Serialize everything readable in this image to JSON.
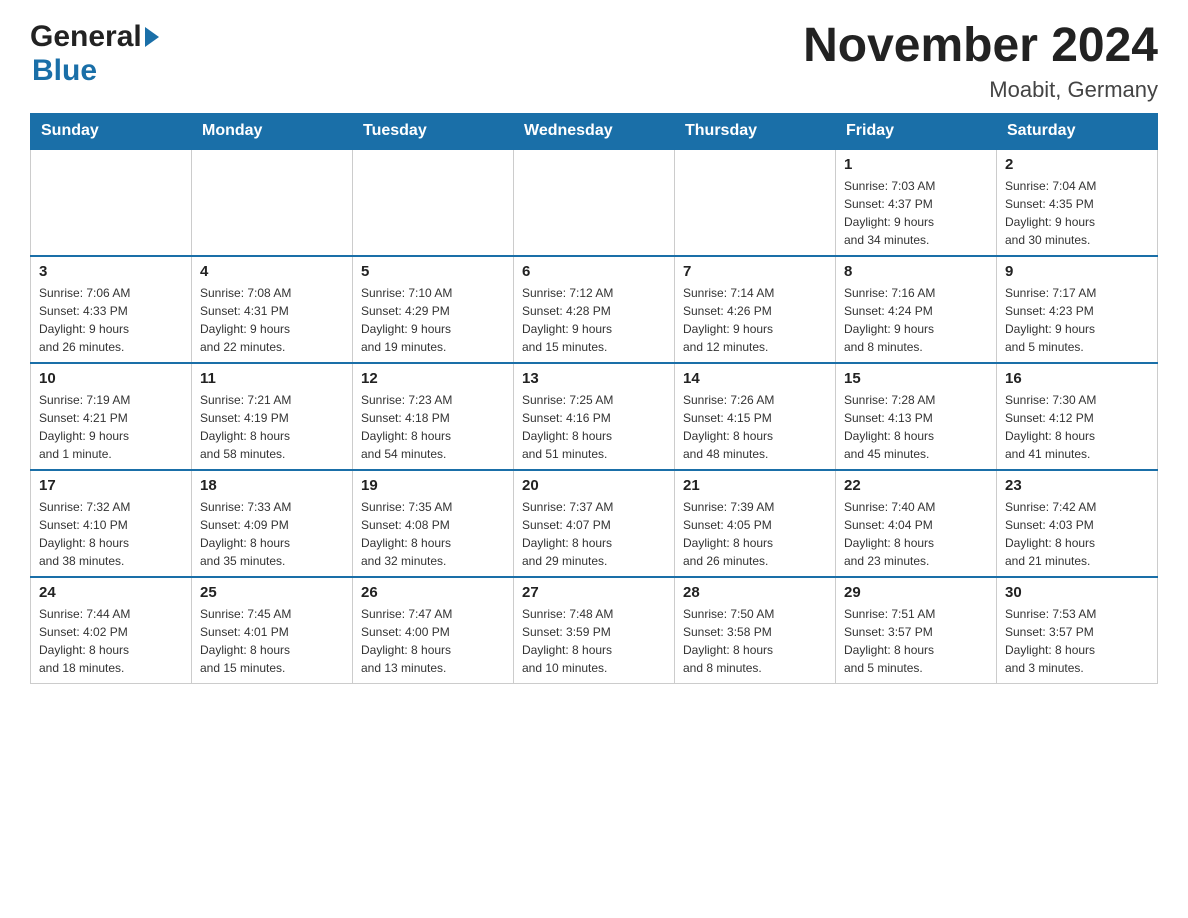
{
  "header": {
    "title": "November 2024",
    "subtitle": "Moabit, Germany",
    "logo_general": "General",
    "logo_blue": "Blue"
  },
  "weekdays": [
    "Sunday",
    "Monday",
    "Tuesday",
    "Wednesday",
    "Thursday",
    "Friday",
    "Saturday"
  ],
  "weeks": [
    {
      "days": [
        {
          "number": "",
          "info": ""
        },
        {
          "number": "",
          "info": ""
        },
        {
          "number": "",
          "info": ""
        },
        {
          "number": "",
          "info": ""
        },
        {
          "number": "",
          "info": ""
        },
        {
          "number": "1",
          "info": "Sunrise: 7:03 AM\nSunset: 4:37 PM\nDaylight: 9 hours\nand 34 minutes."
        },
        {
          "number": "2",
          "info": "Sunrise: 7:04 AM\nSunset: 4:35 PM\nDaylight: 9 hours\nand 30 minutes."
        }
      ]
    },
    {
      "days": [
        {
          "number": "3",
          "info": "Sunrise: 7:06 AM\nSunset: 4:33 PM\nDaylight: 9 hours\nand 26 minutes."
        },
        {
          "number": "4",
          "info": "Sunrise: 7:08 AM\nSunset: 4:31 PM\nDaylight: 9 hours\nand 22 minutes."
        },
        {
          "number": "5",
          "info": "Sunrise: 7:10 AM\nSunset: 4:29 PM\nDaylight: 9 hours\nand 19 minutes."
        },
        {
          "number": "6",
          "info": "Sunrise: 7:12 AM\nSunset: 4:28 PM\nDaylight: 9 hours\nand 15 minutes."
        },
        {
          "number": "7",
          "info": "Sunrise: 7:14 AM\nSunset: 4:26 PM\nDaylight: 9 hours\nand 12 minutes."
        },
        {
          "number": "8",
          "info": "Sunrise: 7:16 AM\nSunset: 4:24 PM\nDaylight: 9 hours\nand 8 minutes."
        },
        {
          "number": "9",
          "info": "Sunrise: 7:17 AM\nSunset: 4:23 PM\nDaylight: 9 hours\nand 5 minutes."
        }
      ]
    },
    {
      "days": [
        {
          "number": "10",
          "info": "Sunrise: 7:19 AM\nSunset: 4:21 PM\nDaylight: 9 hours\nand 1 minute."
        },
        {
          "number": "11",
          "info": "Sunrise: 7:21 AM\nSunset: 4:19 PM\nDaylight: 8 hours\nand 58 minutes."
        },
        {
          "number": "12",
          "info": "Sunrise: 7:23 AM\nSunset: 4:18 PM\nDaylight: 8 hours\nand 54 minutes."
        },
        {
          "number": "13",
          "info": "Sunrise: 7:25 AM\nSunset: 4:16 PM\nDaylight: 8 hours\nand 51 minutes."
        },
        {
          "number": "14",
          "info": "Sunrise: 7:26 AM\nSunset: 4:15 PM\nDaylight: 8 hours\nand 48 minutes."
        },
        {
          "number": "15",
          "info": "Sunrise: 7:28 AM\nSunset: 4:13 PM\nDaylight: 8 hours\nand 45 minutes."
        },
        {
          "number": "16",
          "info": "Sunrise: 7:30 AM\nSunset: 4:12 PM\nDaylight: 8 hours\nand 41 minutes."
        }
      ]
    },
    {
      "days": [
        {
          "number": "17",
          "info": "Sunrise: 7:32 AM\nSunset: 4:10 PM\nDaylight: 8 hours\nand 38 minutes."
        },
        {
          "number": "18",
          "info": "Sunrise: 7:33 AM\nSunset: 4:09 PM\nDaylight: 8 hours\nand 35 minutes."
        },
        {
          "number": "19",
          "info": "Sunrise: 7:35 AM\nSunset: 4:08 PM\nDaylight: 8 hours\nand 32 minutes."
        },
        {
          "number": "20",
          "info": "Sunrise: 7:37 AM\nSunset: 4:07 PM\nDaylight: 8 hours\nand 29 minutes."
        },
        {
          "number": "21",
          "info": "Sunrise: 7:39 AM\nSunset: 4:05 PM\nDaylight: 8 hours\nand 26 minutes."
        },
        {
          "number": "22",
          "info": "Sunrise: 7:40 AM\nSunset: 4:04 PM\nDaylight: 8 hours\nand 23 minutes."
        },
        {
          "number": "23",
          "info": "Sunrise: 7:42 AM\nSunset: 4:03 PM\nDaylight: 8 hours\nand 21 minutes."
        }
      ]
    },
    {
      "days": [
        {
          "number": "24",
          "info": "Sunrise: 7:44 AM\nSunset: 4:02 PM\nDaylight: 8 hours\nand 18 minutes."
        },
        {
          "number": "25",
          "info": "Sunrise: 7:45 AM\nSunset: 4:01 PM\nDaylight: 8 hours\nand 15 minutes."
        },
        {
          "number": "26",
          "info": "Sunrise: 7:47 AM\nSunset: 4:00 PM\nDaylight: 8 hours\nand 13 minutes."
        },
        {
          "number": "27",
          "info": "Sunrise: 7:48 AM\nSunset: 3:59 PM\nDaylight: 8 hours\nand 10 minutes."
        },
        {
          "number": "28",
          "info": "Sunrise: 7:50 AM\nSunset: 3:58 PM\nDaylight: 8 hours\nand 8 minutes."
        },
        {
          "number": "29",
          "info": "Sunrise: 7:51 AM\nSunset: 3:57 PM\nDaylight: 8 hours\nand 5 minutes."
        },
        {
          "number": "30",
          "info": "Sunrise: 7:53 AM\nSunset: 3:57 PM\nDaylight: 8 hours\nand 3 minutes."
        }
      ]
    }
  ]
}
